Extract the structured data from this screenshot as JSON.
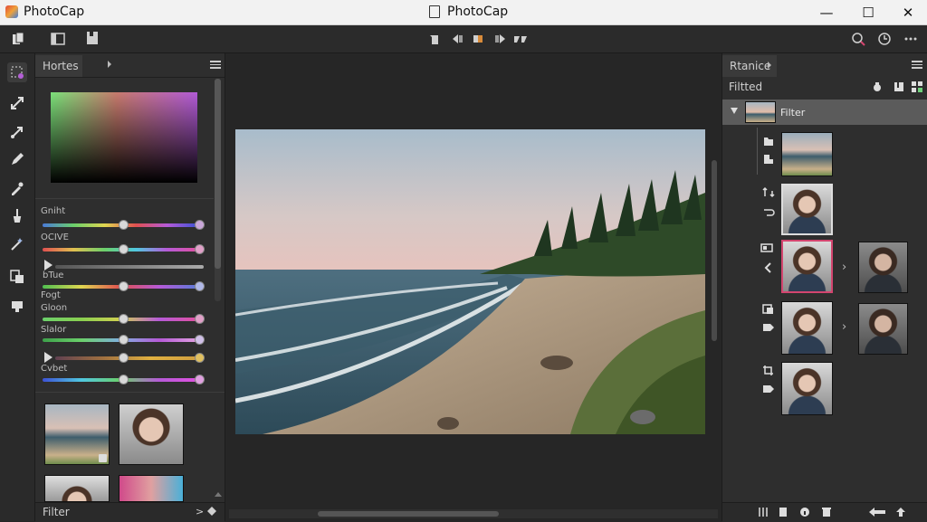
{
  "window": {
    "app_title": "PhotoCap",
    "doc_title": "PhotoCap",
    "minimize": "—",
    "maximize": "☐",
    "close": "✕"
  },
  "left_panel": {
    "tab_label": "Hortes",
    "sliders": [
      {
        "label": "Gniht",
        "value": 0.5
      },
      {
        "label": "OCIVE",
        "value": 0.5
      },
      {
        "label": "",
        "value": 0.5
      },
      {
        "label": "Fogt",
        "value": 0.5
      },
      {
        "label": "Gloon",
        "value": 0.5
      },
      {
        "label": "Slalor",
        "value": 0.5
      },
      {
        "label": "",
        "value": 0.5
      },
      {
        "label": "Cvbet",
        "value": 0.5
      }
    ],
    "slider_extra_labels": [
      "bTue"
    ],
    "footer_label": "Filter"
  },
  "right_panel": {
    "tab_label": "Rtanice",
    "section_label": "Filtted",
    "filter_row_label": "Filter"
  },
  "colors": {
    "accent_pink": "#d3456f"
  }
}
